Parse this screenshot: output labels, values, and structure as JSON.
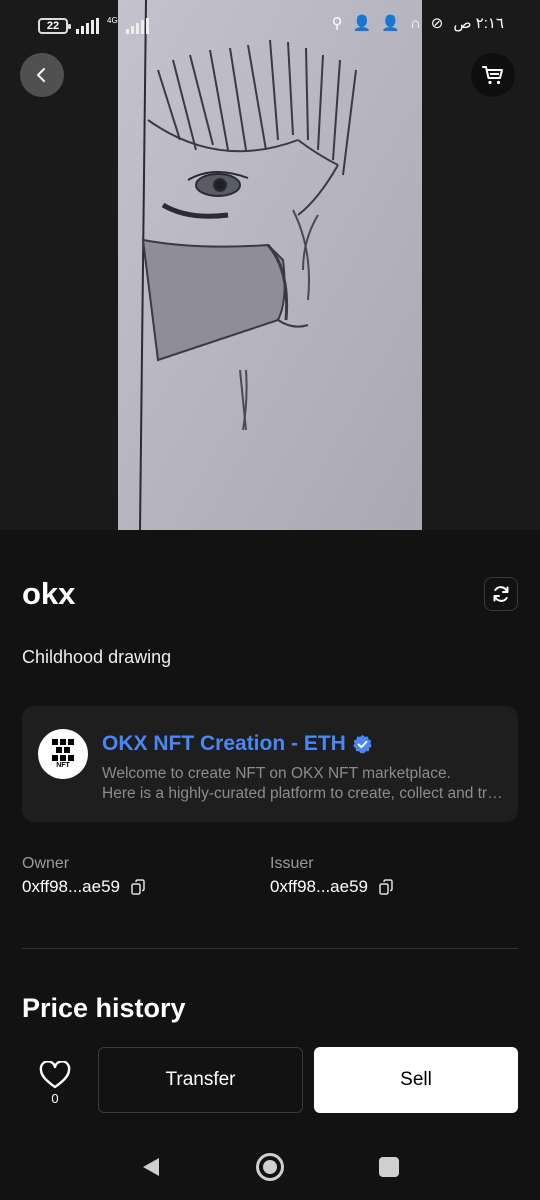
{
  "status_bar": {
    "battery": "22",
    "network_label": "4G",
    "time": "٢:١٦ ص"
  },
  "header": {
    "back_icon": "chevron-left-icon",
    "cart_icon": "cart-icon"
  },
  "nft": {
    "title": "okx",
    "description": "Childhood drawing"
  },
  "collection": {
    "logo_text": "NFT",
    "name": "OKX NFT Creation - ETH",
    "verified_icon": "verified-badge-icon",
    "description_line1": "Welcome to create NFT on OKX NFT marketplace.",
    "description_line2": "Here is a highly-curated platform to create, collect and trade NFTs"
  },
  "owner": {
    "label": "Owner",
    "address": "0xff98...ae59"
  },
  "issuer": {
    "label": "Issuer",
    "address": "0xff98...ae59"
  },
  "price_history": {
    "title": "Price history"
  },
  "actions": {
    "like_count": "0",
    "transfer_label": "Transfer",
    "sell_label": "Sell"
  },
  "colors": {
    "background": "#121212",
    "accent_blue": "#4b86f5",
    "card": "#1e1e1e"
  }
}
